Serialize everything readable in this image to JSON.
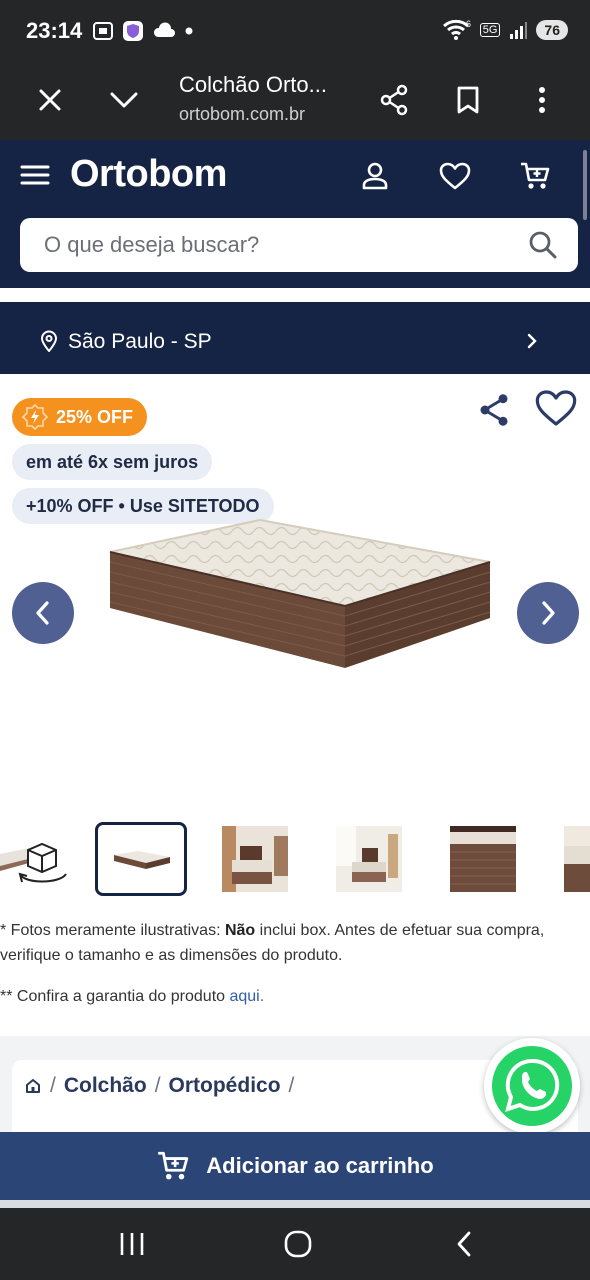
{
  "status_bar": {
    "time": "23:14",
    "battery": "76",
    "network": "5G",
    "wifi_badge": "6",
    "left_icons": [
      "screenshot-icon",
      "vpn-shield-icon",
      "cloud-icon",
      "dot-icon"
    ],
    "right_icons": [
      "wifi-icon",
      "5g-icon",
      "signal-icon",
      "battery-icon"
    ]
  },
  "browser": {
    "title": "Colchão Orto...",
    "url": "ortobom.com.br",
    "icons": [
      "close-icon",
      "chevron-down-icon",
      "share-icon",
      "bookmark-icon",
      "more-vert-icon"
    ]
  },
  "site_header": {
    "logo": "Ortobom",
    "icons": [
      "menu-icon",
      "user-icon",
      "heart-icon",
      "cart-icon"
    ],
    "search_placeholder": "O que deseja buscar?",
    "search_value": ""
  },
  "location": {
    "label": "São Paulo - SP",
    "icons": [
      "pin-icon",
      "chevron-right-icon"
    ]
  },
  "product": {
    "discount_badge": "25% OFF",
    "installments_pill": "em até 6x sem juros",
    "coupon_pill": "+10% OFF • Use SITETODO",
    "carousel_prev": "‹",
    "carousel_next": "›",
    "thumbnails_count": 6,
    "selected_thumbnail": 1,
    "note1_prefix": "* Fotos meramente ilustrativas: ",
    "note1_bold": "Não",
    "note1_suffix": " inclui box. Antes de efetuar sua compra, verifique o tamanho e as dimensões do produto.",
    "note2_prefix": "** Confira a garantia do produto ",
    "note2_link": "aqui."
  },
  "breadcrumb": {
    "items": [
      "Colchão",
      "Ortopédico"
    ],
    "separator": "/"
  },
  "cta": {
    "add_to_cart": "Adicionar ao carrinho"
  },
  "colors": {
    "header_navy": "#152445",
    "badge_orange": "#f5911e",
    "cta_blue": "#2c4577",
    "carousel_btn": "#516092",
    "whatsapp_green": "#25d366"
  },
  "android_nav": {
    "icons": [
      "recent-apps-icon",
      "home-icon",
      "back-icon"
    ]
  }
}
